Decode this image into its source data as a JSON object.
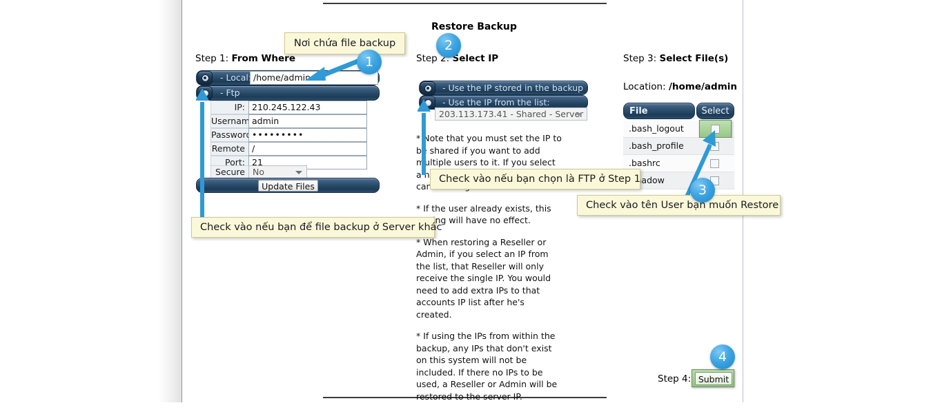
{
  "page": {
    "title": "Restore Backup"
  },
  "step1": {
    "label_prefix": "Step 1:",
    "label": "From Where",
    "local_option": "- Local:",
    "local_value": "/home/admin",
    "ftp_option": "- Ftp",
    "fields": [
      {
        "label": "IP:",
        "value": "210.245.122.43"
      },
      {
        "label": "Username:",
        "value": "admin"
      },
      {
        "label": "Password:",
        "value": "•••••••••"
      },
      {
        "label": "Remote Path:",
        "value": "/"
      },
      {
        "label": "Port:",
        "value": "21"
      }
    ],
    "secure_ftp_label": "Secure FTP:",
    "secure_ftp_value": "No",
    "update_button": "Update Files"
  },
  "step2": {
    "label_prefix": "Step 2:",
    "label": "Select IP",
    "option_backup": "- Use the IP stored in the backup",
    "option_list": "- Use the IP from the list:",
    "ip_select_value": "203.113.173.41 - Shared - Server",
    "notes": [
      "* Note that you must set the IP to be shared if you want to add multiple users to it. If you select a non-shared IP, only one user can be assigned to it.",
      "* If the user already exists, this setting will have no effect.",
      "* When restoring a Reseller or Admin, if you select an IP from the list, that Reseller will only receive the single IP. You would need to add extra IPs to that accounts IP list after he's created.",
      "* If using the IPs from within the backup, any IPs that don't exist on this system will not be included. If there no IPs to be used, a Reseller or Admin will be restored to the server IP."
    ]
  },
  "step3": {
    "label_prefix": "Step 3:",
    "label": "Select File(s)",
    "location_label": "Location:",
    "location_value": "/home/admin",
    "columns": [
      "File",
      "Select"
    ],
    "rows": [
      {
        "file": ".bash_logout",
        "checked": false,
        "highlighted": true
      },
      {
        "file": ".bash_profile",
        "checked": false,
        "highlighted": false
      },
      {
        "file": ".bashrc",
        "checked": false,
        "highlighted": false
      },
      {
        "file": ".shadow",
        "checked": false,
        "highlighted": false
      }
    ]
  },
  "step4": {
    "label_prefix": "Step 4:",
    "submit_button": "Submit"
  },
  "annotations": {
    "callouts": [
      {
        "id": "c1",
        "text": "Nơi chứa file backup"
      },
      {
        "id": "c2",
        "text": "Check vào nếu bạn để file backup ở Server khác"
      },
      {
        "id": "c3",
        "text": "Check vào nếu bạn chọn là FTP ở Step 1"
      },
      {
        "id": "c4",
        "text": "Check vào tên User bạn muốn Restore"
      }
    ],
    "badges": [
      {
        "id": "b1",
        "number": "1"
      },
      {
        "id": "b2",
        "number": "2"
      },
      {
        "id": "b3",
        "number": "3"
      },
      {
        "id": "b4",
        "number": "4"
      }
    ],
    "accent_color": "#2f9ad6",
    "callout_bg": "#fbf8da"
  }
}
